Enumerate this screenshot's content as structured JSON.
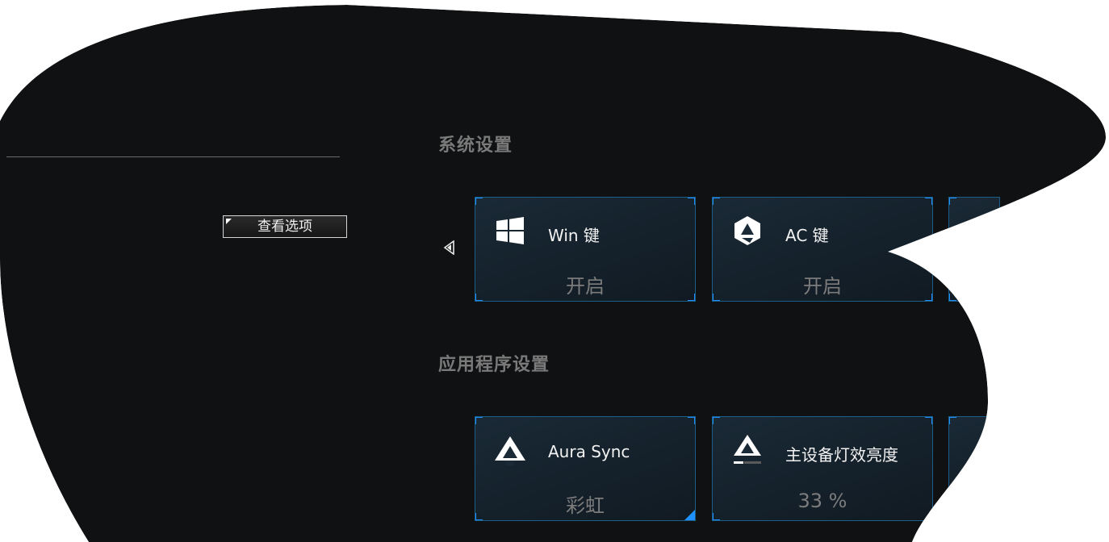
{
  "left_panel": {
    "view_options_label": "查看选项"
  },
  "system_settings": {
    "title": "系统设置",
    "cards": [
      {
        "label": "Win 键",
        "value": "开启",
        "icon": "windows-icon"
      },
      {
        "label": "AC 键",
        "value": "开启",
        "icon": "armoury-crate-icon"
      }
    ]
  },
  "app_settings": {
    "title": "应用程序设置",
    "cards": [
      {
        "label": "Aura Sync",
        "value": "彩虹",
        "icon": "aura-sync-icon"
      },
      {
        "label": "主设备灯效亮度",
        "value": "33 %",
        "icon": "aura-brightness-icon"
      }
    ]
  },
  "colors": {
    "accent": "#1e90ff",
    "background": "#0f1112",
    "section_title": "#7a7a7a",
    "card_value": "#7c7c7c"
  }
}
